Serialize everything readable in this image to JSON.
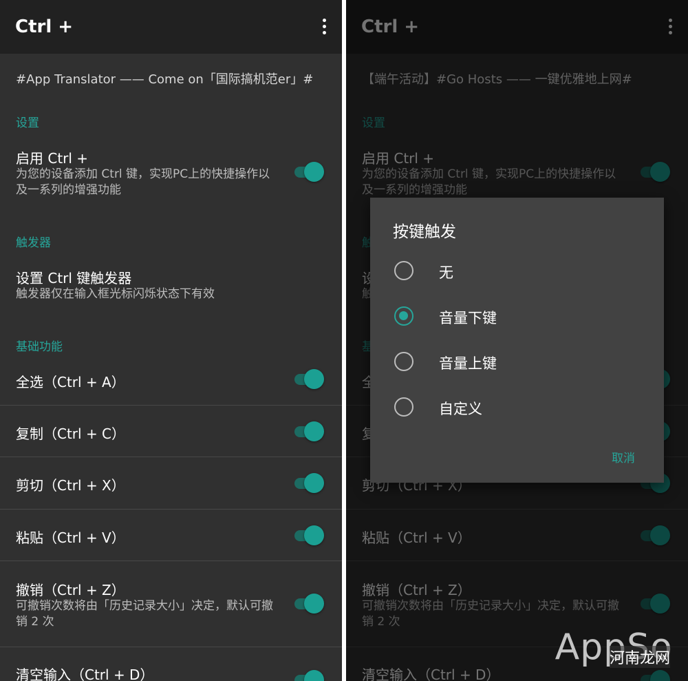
{
  "app": {
    "title": "Ctrl +"
  },
  "left": {
    "banner": "#App Translator —— Come on「国际搞机范er」#"
  },
  "right": {
    "banner": "【端午活动】#Go Hosts —— 一键优雅地上网#"
  },
  "sections": {
    "settings": "设置",
    "trigger": "触发器",
    "basic": "基础功能"
  },
  "prefs": {
    "enable": {
      "title": "启用 Ctrl +",
      "summary": "为您的设备添加 Ctrl 键，实现PC上的快捷操作以及一系列的增强功能",
      "on": true
    },
    "trigger": {
      "title": "设置 Ctrl 键触发器",
      "summary": "触发器仅在输入框光标闪烁状态下有效"
    },
    "select_all": {
      "title": "全选（Ctrl + A）",
      "on": true
    },
    "copy": {
      "title": "复制（Ctrl + C）",
      "on": true
    },
    "cut": {
      "title": "剪切（Ctrl + X）",
      "on": true
    },
    "paste": {
      "title": "粘贴（Ctrl + V）",
      "on": true
    },
    "undo": {
      "title": "撤销（Ctrl + Z）",
      "summary": "可撤销次数将由「历史记录大小」决定，默认可撤销 2 次",
      "on": true
    },
    "clear": {
      "title": "清空输入（Ctrl + D）",
      "on": true
    }
  },
  "dialog": {
    "title": "按键触发",
    "options": [
      {
        "label": "无",
        "checked": false
      },
      {
        "label": "音量下键",
        "checked": true
      },
      {
        "label": "音量上键",
        "checked": false
      },
      {
        "label": "自定义",
        "checked": false
      }
    ],
    "cancel": "取消"
  },
  "watermark": {
    "brand": "AppSo",
    "site": "河南龙网"
  },
  "colors": {
    "accent": "#26a69a",
    "background": "#303030",
    "appbar": "#212121",
    "dialog": "#424242"
  },
  "icons": {
    "overflow": "more-vert-icon"
  }
}
